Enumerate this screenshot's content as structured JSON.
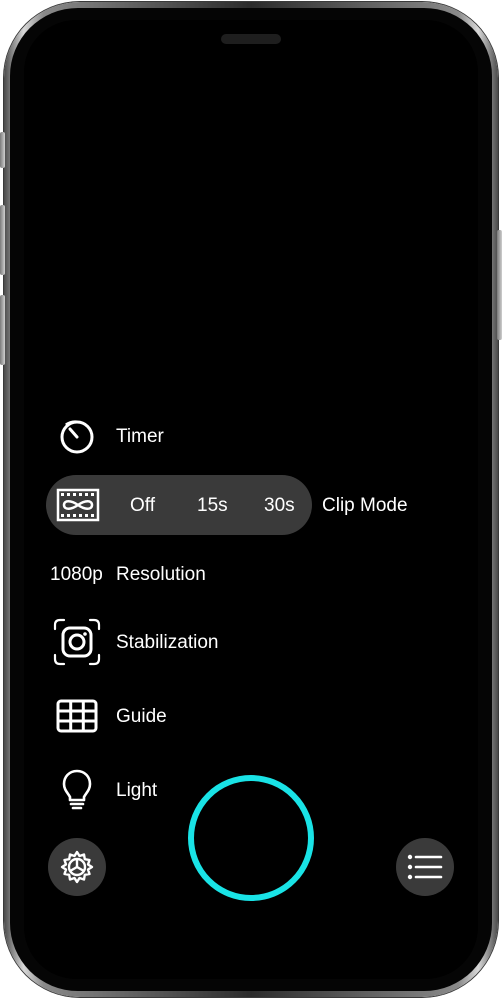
{
  "menu": {
    "timer_label": "Timer",
    "clip_mode_label": "Clip Mode",
    "clip_options": [
      "Off",
      "15s",
      "30s"
    ],
    "resolution_value": "1080p",
    "resolution_label": "Resolution",
    "stabilization_label": "Stabilization",
    "guide_label": "Guide",
    "light_label": "Light"
  },
  "icons": {
    "timer": "timer-icon",
    "clip_mode": "clip-mode-icon",
    "stabilization": "stabilization-icon",
    "guide": "grid-icon",
    "light": "lightbulb-icon",
    "settings": "gear-icon",
    "list": "list-icon"
  },
  "colors": {
    "shutter_ring": "#19e3e6",
    "pill_background": "#3a3a3a",
    "screen_background": "#000000",
    "text": "#ffffff"
  }
}
